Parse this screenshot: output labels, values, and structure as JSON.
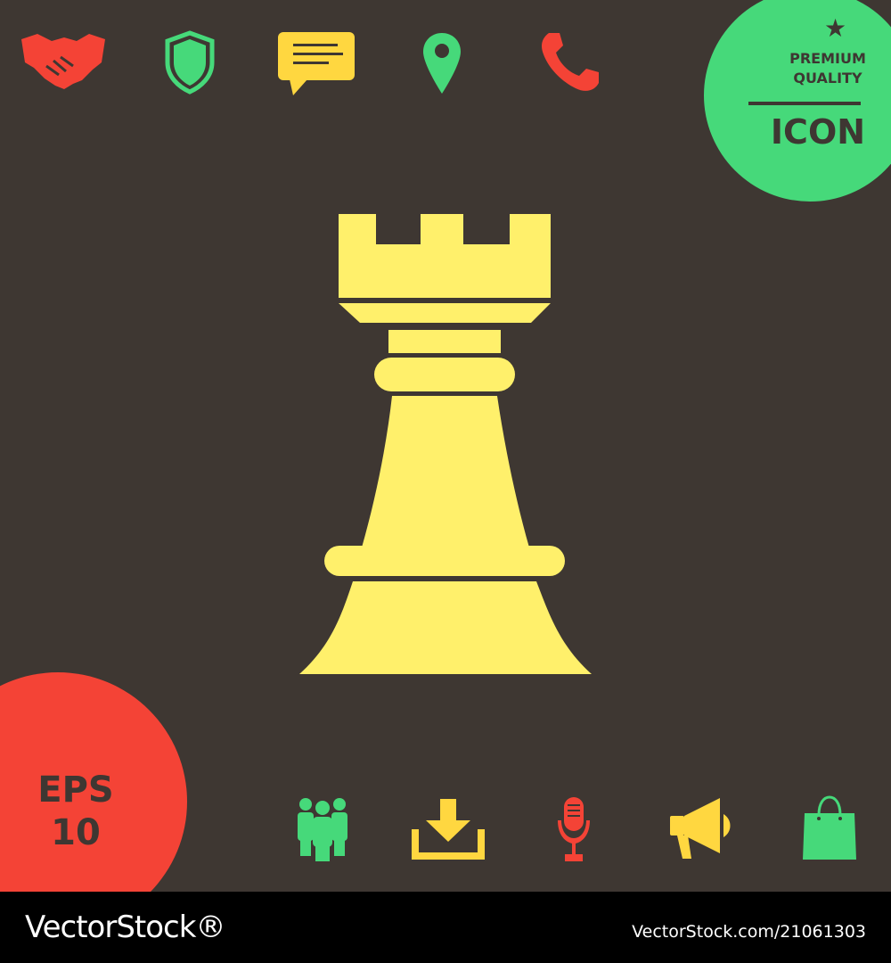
{
  "badge": {
    "line1": "PREMIUM",
    "line2": "QUALITY",
    "label": "ICON",
    "star": "★"
  },
  "format": {
    "line1": "EPS",
    "line2": "10"
  },
  "footer": {
    "brand": "VectorStock®",
    "id": "VectorStock.com/21061303"
  },
  "colors": {
    "background": "#3e3732",
    "rook": "#fff06b",
    "red": "#f44336",
    "green": "#46d97a",
    "yellow": "#ffd740"
  },
  "icons": [
    "handshake-icon",
    "shield-icon",
    "chat-bubble-icon",
    "map-pin-icon",
    "phone-icon",
    "rook-icon",
    "group-icon",
    "download-icon",
    "microphone-icon",
    "megaphone-icon",
    "shopping-bag-icon"
  ]
}
